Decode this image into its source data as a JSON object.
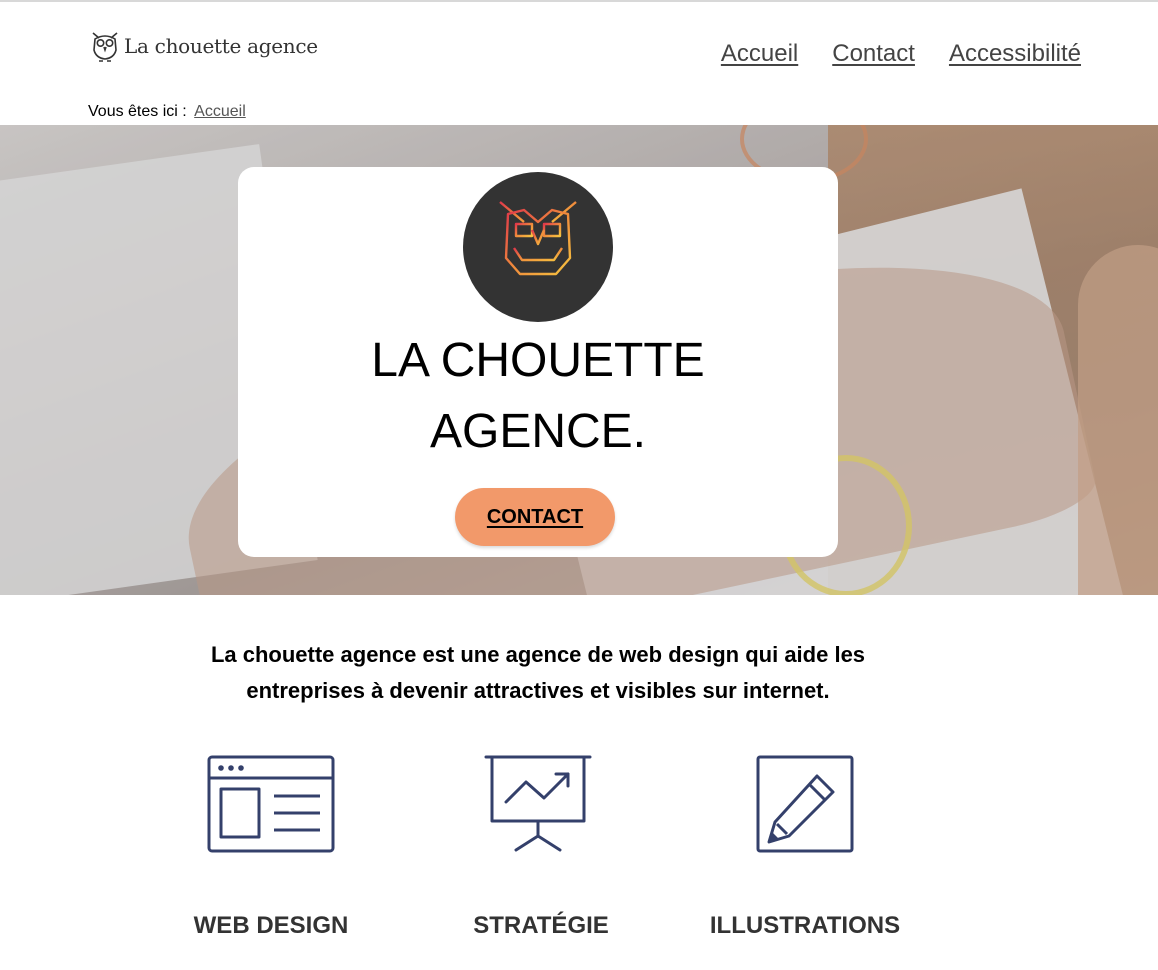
{
  "brand": {
    "name": "La chouette agence",
    "logo_icon": "owl-icon"
  },
  "nav": {
    "items": [
      {
        "label": "Accueil"
      },
      {
        "label": "Contact"
      },
      {
        "label": "Accessibilité"
      }
    ]
  },
  "breadcrumb": {
    "prefix": "Vous êtes ici :",
    "current": "Accueil"
  },
  "hero": {
    "icon": "owl-icon",
    "title": "LA CHOUETTE AGENCE.",
    "cta_label": "CONTACT",
    "colors": {
      "owl_circle": "#333333",
      "cta_bg": "#f2996a"
    }
  },
  "intro": {
    "text": "La chouette agence est une agence de web design qui aide les entreprises à devenir attractives et visibles sur internet."
  },
  "services": [
    {
      "label": "WEB DESIGN",
      "icon": "webpage-layout-icon"
    },
    {
      "label": "STRATÉGIE",
      "icon": "presentation-chart-icon"
    },
    {
      "label": "ILLUSTRATIONS",
      "icon": "pencil-icon"
    }
  ],
  "colors": {
    "icon_stroke": "#34406b",
    "text_dark": "#333333"
  }
}
